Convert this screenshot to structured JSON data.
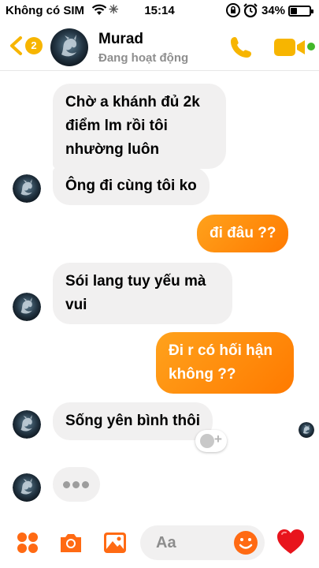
{
  "status_bar": {
    "carrier": "Không có SIM",
    "time": "15:14",
    "battery": "34%",
    "battery_level": 0.34
  },
  "header": {
    "unread_count": "2",
    "contact_name": "Murad",
    "status": "Đang hoạt động"
  },
  "messages": [
    {
      "side": "incoming",
      "text": "Chờ a khánh đủ 2k điểm lm rồi tôi nhường luôn"
    },
    {
      "side": "incoming",
      "text": "Ông đi cùng tôi ko"
    },
    {
      "side": "outgoing",
      "text": "đi đâu ??"
    },
    {
      "side": "incoming",
      "text": "Sói lang tuy yếu mà vui"
    },
    {
      "side": "outgoing",
      "text": "Đi r có hối hận không ??"
    },
    {
      "side": "incoming",
      "text": "Sống yên bình thôi"
    }
  ],
  "composer": {
    "placeholder": "Aa"
  },
  "colors": {
    "accent": "#f7b500",
    "outgoing_bubble": "#ff8c0a",
    "incoming_bubble": "#f1f0f0",
    "composer_icons": "#ff6a13",
    "online": "#42b72a"
  },
  "icons": [
    "wifi-icon",
    "loading-icon",
    "rotation-lock-icon",
    "alarm-icon",
    "battery-icon",
    "back-chevron-icon",
    "phone-icon",
    "video-call-icon",
    "more-apps-icon",
    "camera-icon",
    "gallery-icon",
    "emoji-icon",
    "heart-icon"
  ]
}
